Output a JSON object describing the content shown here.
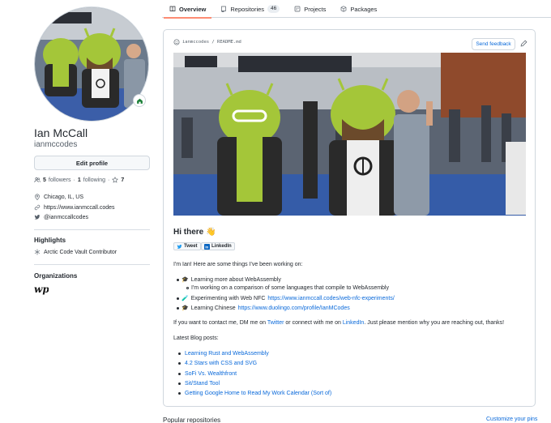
{
  "tabs": [
    {
      "label": "Overview",
      "icon": "book-icon"
    },
    {
      "label": "Repositories",
      "icon": "repo-icon",
      "count": "46"
    },
    {
      "label": "Projects",
      "icon": "project-icon"
    },
    {
      "label": "Packages",
      "icon": "package-icon"
    }
  ],
  "profile": {
    "name": "Ian McCall",
    "login": "ianmccodes",
    "edit_label": "Edit profile",
    "followers_count": "5",
    "followers_label": "followers",
    "following_count": "1",
    "following_label": "following",
    "separator": "·",
    "stars": "7",
    "location": "Chicago, IL, US",
    "website": "https://www.ianmccall.codes",
    "twitter": "@ianmccallcodes"
  },
  "highlights": {
    "title": "Highlights",
    "item": "Arctic Code Vault Contributor"
  },
  "organizations": {
    "title": "Organizations"
  },
  "readme": {
    "path": "ianmccodes / README.md",
    "feedback_label": "Send feedback",
    "greeting": "Hi there",
    "greeting_emoji": "👋",
    "tweet_label": "Tweet",
    "linkedin_label": "LinkedIn",
    "intro": "I'm Ian! Here are some things I've been working on:",
    "items": [
      {
        "emoji": "🎓",
        "text": "Learning more about WebAssembly",
        "link": ""
      },
      {
        "emoji": "",
        "text": "I'm working on a comparison of some languages that compile to WebAssembly",
        "link": ""
      },
      {
        "emoji": "🧪",
        "text": "Experimenting with Web NFC",
        "link": "https://www.ianmccall.codes/web-nfc-experiments/"
      },
      {
        "emoji": "🎓",
        "text": "Learning Chinese",
        "link": "https://www.duolingo.com/profile/IanMCodes"
      }
    ],
    "contact_pre": "If you want to contact me, DM me on",
    "contact_twitter": "Twitter",
    "contact_mid": "or connect with me on",
    "contact_linkedin": "LinkedIn",
    "contact_post": ". Just please mention why you are reaching out, thanks!",
    "blog_heading": "Latest Blog posts:",
    "blog_posts": [
      "Learning Rust and WebAssembly",
      "4.2 Stars with CSS and SVG",
      "SoFi Vs. Wealthfront",
      "Sit/Stand Tool",
      "Getting Google Home to Read My Work Calendar (Sort of)"
    ]
  },
  "footer": {
    "popular": "Popular repositories",
    "customize": "Customize your pins"
  },
  "colors": {
    "accent": "#fd8c73",
    "link": "#0969da",
    "android_green": "#a4c639"
  }
}
